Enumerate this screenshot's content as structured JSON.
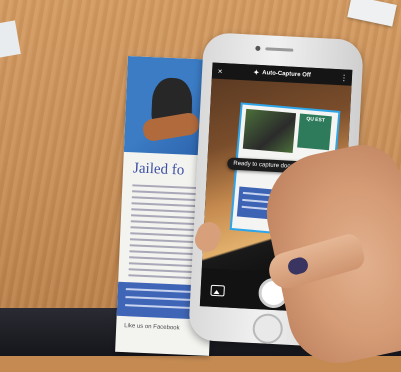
{
  "brochure": {
    "headline": "Jailed fo",
    "social": [
      "Like us on Facebook"
    ]
  },
  "app": {
    "close_icon": "×",
    "mode_icon": "wand-icon",
    "title": "Auto-Capture Off",
    "more_icon": "⋮",
    "toast": "Ready to capture document",
    "doc_logo_line1": "QU EST",
    "doc_logo_line2": ""
  },
  "colors": {
    "accent": "#2fa5e9",
    "brochure_blue": "#3f66b6"
  }
}
